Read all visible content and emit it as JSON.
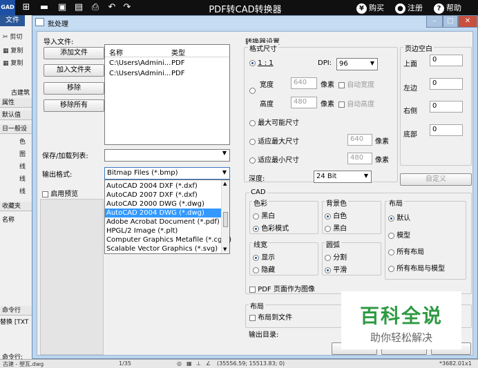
{
  "app": {
    "logo": "GAD",
    "title": "PDF转CAD转换器",
    "buy": "购买",
    "register": "注册",
    "help": "帮助"
  },
  "background": {
    "menu_file": "文件",
    "tools": [
      "剪切",
      "复制",
      "复制"
    ],
    "panel_tab": "古建筑",
    "props_label": "属性",
    "default_value": "默认值",
    "general": "日一般设",
    "prop_rows": [
      "色",
      "图",
      "线",
      "线",
      "线"
    ],
    "favorites": "收藏夹",
    "name_label": "名称",
    "cmd_label": "命令行",
    "replace_label": "替换 [TXT",
    "cmd_prompt": "命令行:",
    "status": "古建 - 塑瓦.dwg",
    "page": "1/35",
    "coords": "(35556.59; 15513.83; 0)",
    "right_status": "*3682.01x1"
  },
  "dialog": {
    "title": "批处理",
    "import_label": "导入文件:",
    "add_file": "添加文件",
    "add_folder": "加入文件夹",
    "remove": "移除",
    "remove_all": "移除所有",
    "file_table": {
      "headers": [
        "名称",
        "类型"
      ],
      "rows": [
        [
          "C:\\Users\\Admini...",
          "PDF"
        ],
        [
          "C:\\Users\\Admini...",
          "PDF"
        ]
      ]
    },
    "save_list_label": "保存/加载列表:",
    "output_format_label": "输出格式:",
    "output_format_value": "Bitmap Files (*.bmp)",
    "format_options": [
      "AutoCAD 2004 DXF (*.dxf)",
      "AutoCAD 2007 DXF (*.dxf)",
      "AutoCAD 2000 DWG (*.dwg)",
      "AutoCAD 2004 DWG (*.dwg)",
      "Adobe Acrobat Document (*.pdf)",
      "HPGL/2 Image (*.plt)",
      "Computer Graphics Metafile (*.cgm)",
      "Scalable Vector Graphics (*.svg)"
    ],
    "enable_preview": "启用预览",
    "converter": {
      "title": "转换器设置",
      "format_size": "格式尺寸",
      "ratio": "1 : 1",
      "dpi_label": "DPI:",
      "dpi_value": "96",
      "width_label": "宽度",
      "width_value": "640",
      "height_label": "高度",
      "height_value": "480",
      "pixels": "像素",
      "auto_width": "自动宽度",
      "auto_height": "自动高度",
      "max_size": "最大可能尺寸",
      "fit_max": "适应最大尺寸",
      "fit_min": "适应最小尺寸",
      "fit_max_value": "640",
      "fit_min_value": "480",
      "depth_label": "深度:",
      "depth_value": "24 Bit",
      "margins_title": "页边空白",
      "top": "上面",
      "left": "左边",
      "right": "右侧",
      "bottom": "底部",
      "margin_values": [
        "0",
        "0",
        "0",
        "0"
      ],
      "custom": "自定义"
    },
    "cad": {
      "title": "CAD",
      "color_title": "色彩",
      "bw": "黑白",
      "color_mode": "色彩模式",
      "bg_title": "背景色",
      "white": "白色",
      "black": "黑白",
      "layout_title": "布局",
      "default": "默认",
      "model": "模型",
      "all_layouts": "所有布局",
      "all_layouts_model": "所有布局与模型",
      "lineweight_title": "线宽",
      "show": "显示",
      "hide": "隐藏",
      "arc_title": "圆弧",
      "split": "分割",
      "smooth": "平滑",
      "pdf_as_image": "PDF 页面作为图像"
    },
    "layout": {
      "title": "布局",
      "layout_to_file": "布局到文件"
    },
    "output_dir_label": "输出目录:"
  },
  "watermark": {
    "big": "百科全说",
    "small": "助你轻松解决"
  },
  "colors": {
    "accent": "#3399ff",
    "watermark_green": "#2e9a43"
  }
}
